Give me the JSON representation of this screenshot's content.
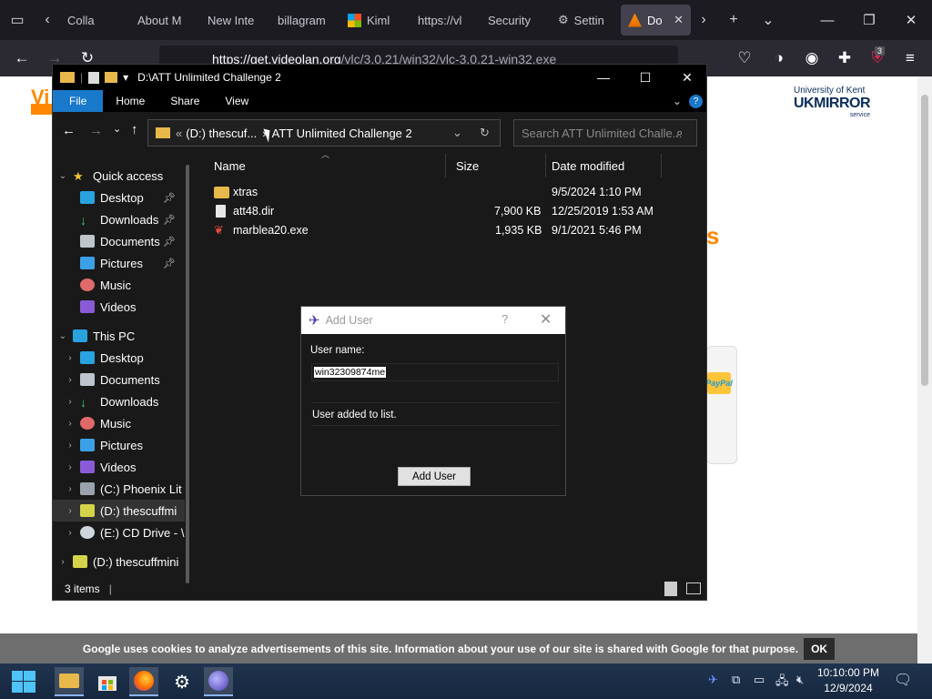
{
  "browser": {
    "tabs": [
      {
        "label": "Colla",
        "active": false
      },
      {
        "label": "About M",
        "active": false
      },
      {
        "label": "New Inte",
        "active": false
      },
      {
        "label": "billagram",
        "active": false
      },
      {
        "label": "Kiml",
        "active": false
      },
      {
        "label": "https://vl",
        "active": false
      },
      {
        "label": "Security",
        "active": false
      },
      {
        "label": "Settin",
        "active": false
      },
      {
        "label": "Do",
        "active": true
      }
    ],
    "url_host": "https://get.videolan.org",
    "url_path": "/vlc/3.0.21/win32/vlc-3.0.21-win32.exe",
    "ext_badge": "3"
  },
  "page": {
    "vl_logo": "Vi",
    "ukm_line1": "University of Kent",
    "ukm_line2": "UKMIRROR",
    "ukm_line3": "service",
    "orange_letter": "s",
    "paypal": "PayPal"
  },
  "cookie": {
    "text": "Google uses cookies to analyze advertisements of this site. Information about your use of our site is shared with Google for that purpose.",
    "ok": "OK"
  },
  "explorer": {
    "title": "D:\\ATT Unlimited Challenge 2",
    "ribbon": [
      "File",
      "Home",
      "Share",
      "View"
    ],
    "address_prefix": "«",
    "address_parent": "(D:) thescuf...",
    "address_current": "ATT Unlimited Challenge 2",
    "search_placeholder": "Search ATT Unlimited Challe...",
    "columns": {
      "name": "Name",
      "size": "Size",
      "date": "Date modified"
    },
    "files": [
      {
        "name": "xtras",
        "size": "",
        "date": "9/5/2024 1:10 PM",
        "kind": "folder"
      },
      {
        "name": "att48.dir",
        "size": "7,900 KB",
        "date": "12/25/2019 1:53 AM",
        "kind": "file"
      },
      {
        "name": "marblea20.exe",
        "size": "1,935 KB",
        "date": "9/1/2021 5:46 PM",
        "kind": "exe"
      }
    ],
    "tree": {
      "quick_access": "Quick access",
      "qa_desktop": "Desktop",
      "qa_downloads": "Downloads",
      "qa_documents": "Documents",
      "qa_pictures": "Pictures",
      "qa_music": "Music",
      "qa_videos": "Videos",
      "this_pc": "This PC",
      "pc_desktop": "Desktop",
      "pc_documents": "Documents",
      "pc_downloads": "Downloads",
      "pc_music": "Music",
      "pc_pictures": "Pictures",
      "pc_videos": "Videos",
      "drive_c": "(C:) Phoenix Lit",
      "drive_d": "(D:) thescuffmi",
      "drive_e": "(E:) CD Drive - \\",
      "drive_d2": "(D:) thescuffmini"
    },
    "status": "3 items"
  },
  "dialog": {
    "title": "Add User",
    "help": "?",
    "label": "User name:",
    "value": "win32309874me",
    "message": "User added to list.",
    "button": "Add User"
  },
  "taskbar": {
    "time": "10:10:00 PM",
    "date": "12/9/2024"
  },
  "colors": {
    "file_tab": "#1979ca",
    "cookie_bar": "#6e6e6e",
    "brand_orange": "#ff8800"
  }
}
